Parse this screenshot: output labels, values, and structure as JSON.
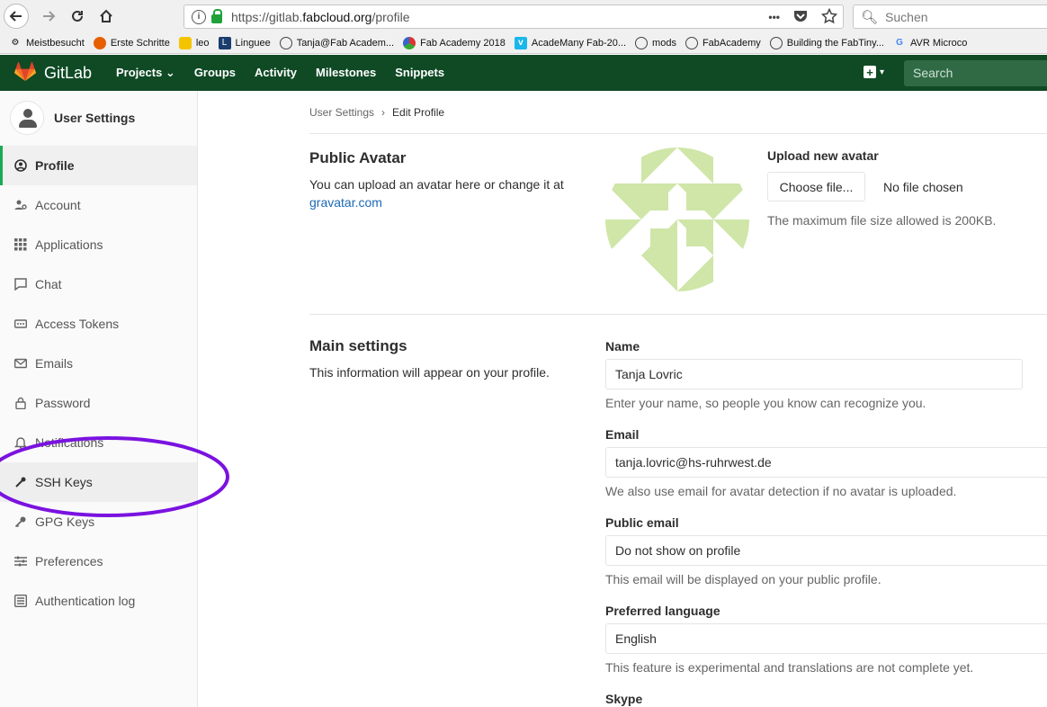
{
  "browser": {
    "url_prefix": "https://gitlab.",
    "url_domain": "fabcloud.org",
    "url_path": "/profile",
    "search_placeholder": "Suchen",
    "menu_dots": "•••"
  },
  "bookmarks": [
    {
      "label": "Meistbesucht",
      "icon": "gear-icon"
    },
    {
      "label": "Erste Schritte",
      "icon": "firefox-icon"
    },
    {
      "label": "leo",
      "icon": "leo-icon"
    },
    {
      "label": "Linguee",
      "icon": "linguee-icon"
    },
    {
      "label": "Tanja@Fab Academ...",
      "icon": "globe-icon"
    },
    {
      "label": "Fab Academy 2018",
      "icon": "fab-icon"
    },
    {
      "label": "AcadeMany Fab-20...",
      "icon": "vimeo-icon"
    },
    {
      "label": "mods",
      "icon": "globe-icon"
    },
    {
      "label": "FabAcademy",
      "icon": "globe-icon"
    },
    {
      "label": "Building the FabTiny...",
      "icon": "globe-icon"
    },
    {
      "label": "AVR Microco",
      "icon": "google-icon"
    }
  ],
  "gitlab": {
    "brand": "GitLab",
    "nav": [
      "Projects ⌄",
      "Groups",
      "Activity",
      "Milestones",
      "Snippets"
    ],
    "search_placeholder": "Search",
    "brand_color": "#0f4a25"
  },
  "sidebar": {
    "title": "User Settings",
    "items": [
      {
        "label": "Profile",
        "icon": "profile-icon"
      },
      {
        "label": "Account",
        "icon": "account-icon"
      },
      {
        "label": "Applications",
        "icon": "applications-icon"
      },
      {
        "label": "Chat",
        "icon": "chat-icon"
      },
      {
        "label": "Access Tokens",
        "icon": "token-icon"
      },
      {
        "label": "Emails",
        "icon": "email-icon"
      },
      {
        "label": "Password",
        "icon": "lock-icon"
      },
      {
        "label": "Notifications",
        "icon": "bell-icon"
      },
      {
        "label": "SSH Keys",
        "icon": "key-icon"
      },
      {
        "label": "GPG Keys",
        "icon": "key-icon"
      },
      {
        "label": "Preferences",
        "icon": "preferences-icon"
      },
      {
        "label": "Authentication log",
        "icon": "log-icon"
      }
    ]
  },
  "breadcrumb": {
    "parent": "User Settings",
    "sep": "›",
    "current": "Edit Profile"
  },
  "avatar_section": {
    "title": "Public Avatar",
    "desc": "You can upload an avatar here or change it at",
    "link": "gravatar.com",
    "upload_title": "Upload new avatar",
    "choose_label": "Choose file...",
    "no_file": "No file chosen",
    "max_size": "The maximum file size allowed is 200KB."
  },
  "main_settings": {
    "title": "Main settings",
    "desc": "This information will appear on your profile.",
    "fields": [
      {
        "label": "Name",
        "value": "Tanja Lovric",
        "help": "Enter your name, so people you know can recognize you."
      },
      {
        "label": "Email",
        "value": "tanja.lovric@hs-ruhrwest.de",
        "help": "We also use email for avatar detection if no avatar is uploaded."
      },
      {
        "label": "Public email",
        "value": "Do not show on profile",
        "help": "This email will be displayed on your public profile."
      },
      {
        "label": "Preferred language",
        "value": "English",
        "help": "This feature is experimental and translations are not complete yet."
      },
      {
        "label": "Skype"
      }
    ]
  },
  "colors": {
    "accent": "#1aaa55",
    "link": "#1b69b6",
    "annotation": "#7a12e0",
    "avatar": "#cfe6a8"
  }
}
